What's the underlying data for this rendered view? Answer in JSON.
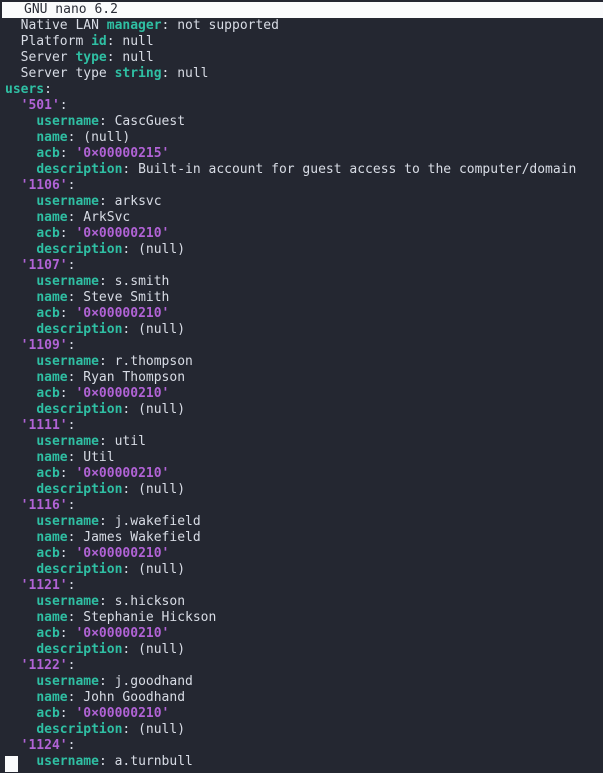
{
  "editor": {
    "name": "GNU nano",
    "version": "6.2",
    "title": "GNU nano 6.2",
    "background_color": "#242731",
    "titlebar_background": "#fafbfc",
    "titlebar_text_color": "#2a2d37",
    "key_color": "#2fbfa3",
    "string_color": "#b163d6",
    "value_color": "#d8dce5",
    "cursor_color": "#fafbfc"
  },
  "header_lines": [
    {
      "indent": 2,
      "key": "Native LAN ",
      "key_bold": "manager",
      "sep": ": ",
      "value": "not supported"
    },
    {
      "indent": 2,
      "key": "Platform ",
      "key_bold": "id",
      "sep": ": ",
      "value": "null"
    },
    {
      "indent": 2,
      "key": "Server ",
      "key_bold": "type",
      "sep": ": ",
      "value": "null"
    },
    {
      "indent": 2,
      "key": "Server type ",
      "key_bold": "string",
      "sep": ": ",
      "value": "null"
    }
  ],
  "root_key": "users",
  "field_labels": {
    "username": "username",
    "name": "name",
    "acb": "acb",
    "description": "description"
  },
  "users": [
    {
      "rid": "'501'",
      "username": "CascGuest",
      "name": "(null)",
      "acb": "'0×00000215'",
      "description": "Built-in account for guest access to the computer/domain"
    },
    {
      "rid": "'1106'",
      "username": "arksvc",
      "name": "ArkSvc",
      "acb": "'0×00000210'",
      "description": "(null)"
    },
    {
      "rid": "'1107'",
      "username": "s.smith",
      "name": "Steve Smith",
      "acb": "'0×00000210'",
      "description": "(null)"
    },
    {
      "rid": "'1109'",
      "username": "r.thompson",
      "name": "Ryan Thompson",
      "acb": "'0×00000210'",
      "description": "(null)"
    },
    {
      "rid": "'1111'",
      "username": "util",
      "name": "Util",
      "acb": "'0×00000210'",
      "description": "(null)"
    },
    {
      "rid": "'1116'",
      "username": "j.wakefield",
      "name": "James Wakefield",
      "acb": "'0×00000210'",
      "description": "(null)"
    },
    {
      "rid": "'1121'",
      "username": "s.hickson",
      "name": "Stephanie Hickson",
      "acb": "'0×00000210'",
      "description": "(null)"
    },
    {
      "rid": "'1122'",
      "username": "j.goodhand",
      "name": "John Goodhand",
      "acb": "'0×00000210'",
      "description": "(null)"
    },
    {
      "rid": "'1124'",
      "username": "a.turnbull",
      "name": null,
      "acb": null,
      "description": null
    }
  ]
}
